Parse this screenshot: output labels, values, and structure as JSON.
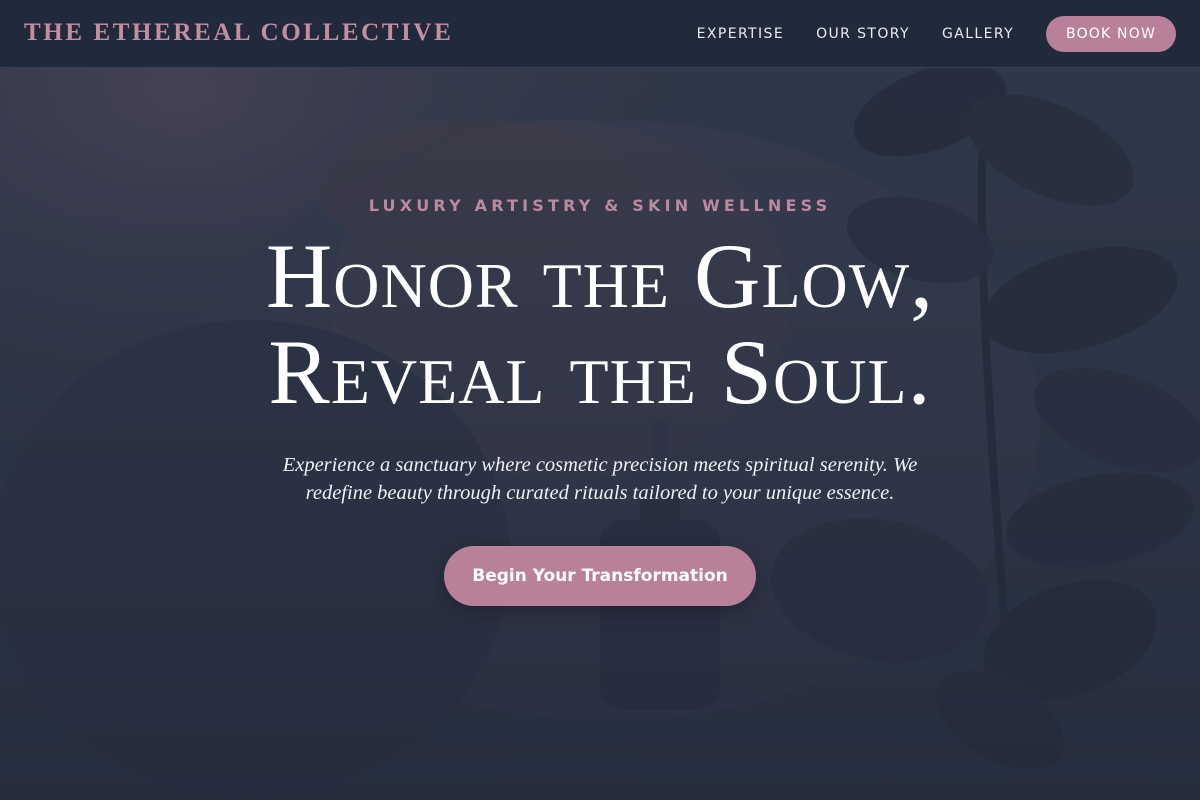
{
  "brand": {
    "name": "THE ETHEREAL COLLECTIVE"
  },
  "nav": {
    "links": [
      {
        "label": "EXPERTISE"
      },
      {
        "label": "OUR STORY"
      },
      {
        "label": "GALLERY"
      }
    ],
    "cta_label": "BOOK NOW"
  },
  "hero": {
    "eyebrow": "LUXURY ARTISTRY & SKIN WELLNESS",
    "headline_line1": "Honor the Glow,",
    "headline_line2": "Reveal the Soul.",
    "subtext": "Experience a sanctuary where cosmetic precision meets spiritual serenity. We redefine beauty through curated rituals tailored to your unique essence.",
    "cta_label": "Begin Your Transformation"
  },
  "colors": {
    "accent": "#b9809a",
    "navbar_bg": "#212a3b",
    "hero_bg": "#2f3848",
    "brand_text": "#c48da3"
  }
}
